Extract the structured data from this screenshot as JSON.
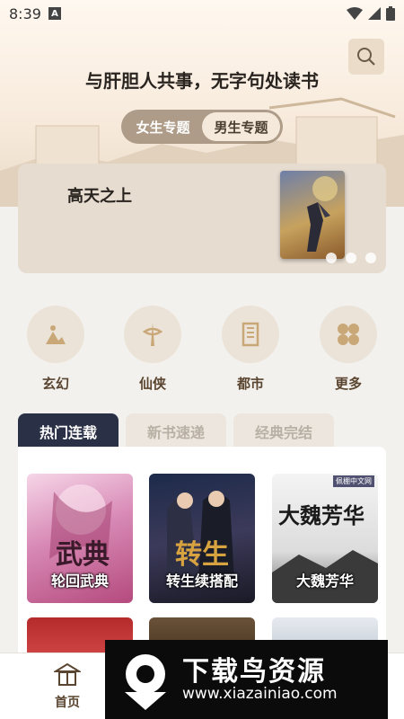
{
  "status_bar": {
    "time": "8:39",
    "a_badge": "A"
  },
  "hero": {
    "slogan": "与肝胆人共事，无字句处读书"
  },
  "topic_toggle": {
    "female": "女生专题",
    "male": "男生专题",
    "active": "male"
  },
  "banner": {
    "title": "高天之上",
    "cover_text": "高天之上",
    "slide_count": 3
  },
  "categories": [
    {
      "label": "玄幻",
      "icon": "xuanhuan-icon"
    },
    {
      "label": "仙侠",
      "icon": "xianxia-icon"
    },
    {
      "label": "都市",
      "icon": "dushi-icon"
    },
    {
      "label": "更多",
      "icon": "more-grid-icon"
    }
  ],
  "tabs": [
    {
      "label": "热门连载",
      "active": true
    },
    {
      "label": "新书速递",
      "active": false
    },
    {
      "label": "经典完结",
      "active": false
    }
  ],
  "books": [
    {
      "cover_title": "轮回武典",
      "cover_top": "武典",
      "badge": ""
    },
    {
      "cover_title": "转生续搭配",
      "cover_top": "转生",
      "badge": ""
    },
    {
      "cover_title": "大魏芳华",
      "cover_top": "大魏芳华",
      "badge": "佩棚中文网"
    }
  ],
  "bottom_nav": {
    "home": "首页"
  },
  "watermark": {
    "title": "下载鸟资源",
    "url": "www.xiazainiao.com"
  },
  "colors": {
    "accent_dark": "#2a3146",
    "brown_text": "#5a4530",
    "hero_bg": "#f7eadb"
  }
}
